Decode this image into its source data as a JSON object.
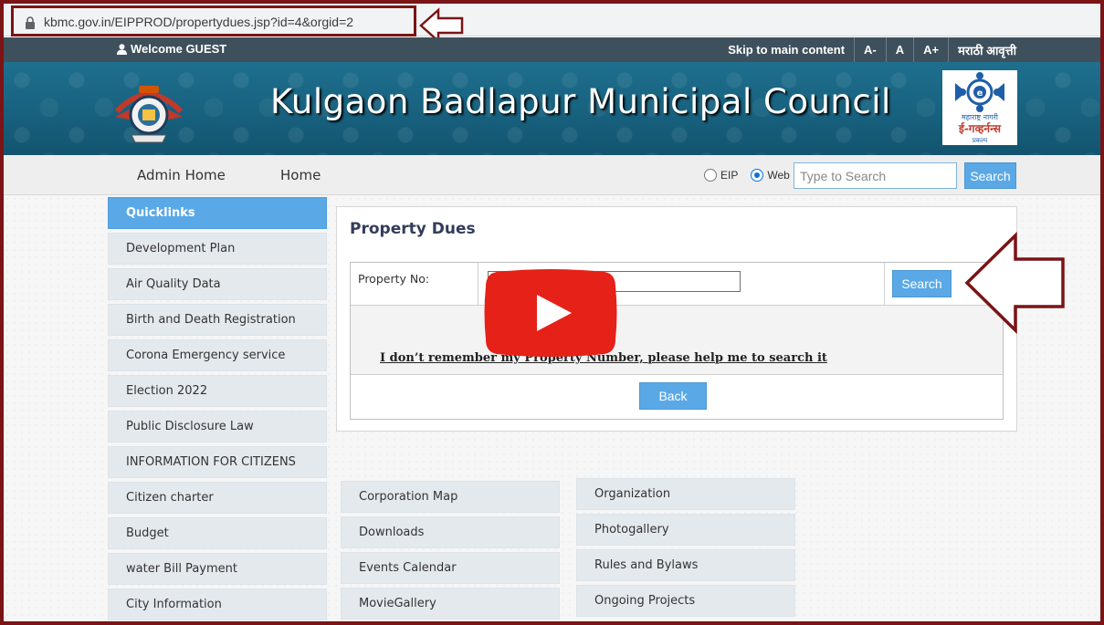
{
  "browser": {
    "url": "kbmc.gov.in/EIPPROD/propertydues.jsp?id=4&orgid=2"
  },
  "topbar": {
    "welcome": "Welcome GUEST",
    "skip": "Skip to main content",
    "font_small": "A-",
    "font_normal": "A",
    "font_large": "A+",
    "language": "मराठी आवृत्ती"
  },
  "banner": {
    "title": "Kulgaon Badlapur Municipal Council",
    "egov_text_1": "महाराष्ट्र नागरी",
    "egov_text_2": "ई-गव्हर्नन्स",
    "egov_text_3": "प्रकल्प"
  },
  "nav": {
    "admin_home": "Admin Home",
    "home": "Home",
    "radio_eip": "EIP",
    "radio_web": "Web",
    "search_placeholder": "Type to Search",
    "search_button": "Search"
  },
  "sidebar": {
    "items": [
      {
        "label": "Quicklinks"
      },
      {
        "label": "Development Plan"
      },
      {
        "label": "Air Quality Data"
      },
      {
        "label": "Birth and Death Registration"
      },
      {
        "label": "Corona Emergency service"
      },
      {
        "label": "Election 2022"
      },
      {
        "label": "Public Disclosure Law"
      },
      {
        "label": "INFORMATION FOR CITIZENS"
      },
      {
        "label": "Citizen charter"
      },
      {
        "label": "Budget"
      },
      {
        "label": "water Bill Payment"
      },
      {
        "label": "City Information"
      }
    ]
  },
  "panel": {
    "title": "Property Dues",
    "property_label": "Property No:",
    "search_button": "Search",
    "help_link": "I don’t remember my Property Number, please help me to search it",
    "back_button": "Back"
  },
  "links_col1": [
    {
      "label": "Corporation Map"
    },
    {
      "label": "Downloads"
    },
    {
      "label": "Events Calendar"
    },
    {
      "label": "MovieGallery"
    }
  ],
  "links_col2": [
    {
      "label": "Organization"
    },
    {
      "label": "Photogallery"
    },
    {
      "label": "Rules and Bylaws"
    },
    {
      "label": "Ongoing Projects"
    }
  ],
  "colors": {
    "frame": "#7a1416",
    "accent": "#5aa9e6",
    "topbar": "#3e505c",
    "banner": "#1e6f8e",
    "youtube": "#e62117"
  }
}
